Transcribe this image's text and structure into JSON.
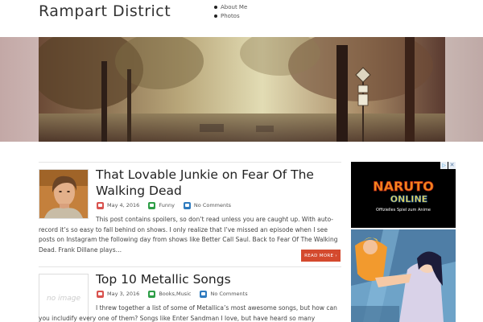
{
  "site": {
    "title": "Rampart District"
  },
  "nav": {
    "items": [
      "About Me",
      "Photos"
    ]
  },
  "posts": [
    {
      "title": "That Lovable Junkie on Fear Of The Walking Dead",
      "date": "May 4, 2016",
      "category": "Funny",
      "comments": "No Comments",
      "excerpt": "This post contains spoilers, so don’t read unless you are caught up. With auto-record it’s so easy to fall behind on shows. I only realize that I’ve missed an episode when I see posts on Instagram the following day from shows like Better Call Saul. Back to Fear Of The Walking Dead. Frank Dillane plays…",
      "read_more": "READ MORE ›"
    },
    {
      "title": "Top 10 Metallic Songs",
      "date": "May 3, 2016",
      "category": "Books,Music",
      "comments": "No Comments",
      "thumb_text": "no image",
      "excerpt": "I threw together a list of some of Metallica’s most awesome songs, but how can you includify every one of them? Songs like Enter Sandman I love, but have heard so many"
    }
  ],
  "sidebar": {
    "ad1": {
      "logo_top": "NARUTO",
      "logo_bottom": "ONLINE",
      "tagline": "Offizielles Spiel zum Anime",
      "close": "✕",
      "choice": "▷"
    }
  },
  "colors": {
    "read_more_bg": "#d44a2e",
    "date_icon": "#d9534f",
    "category_icon": "#2e9e47",
    "comment_icon": "#2f7bbf"
  }
}
